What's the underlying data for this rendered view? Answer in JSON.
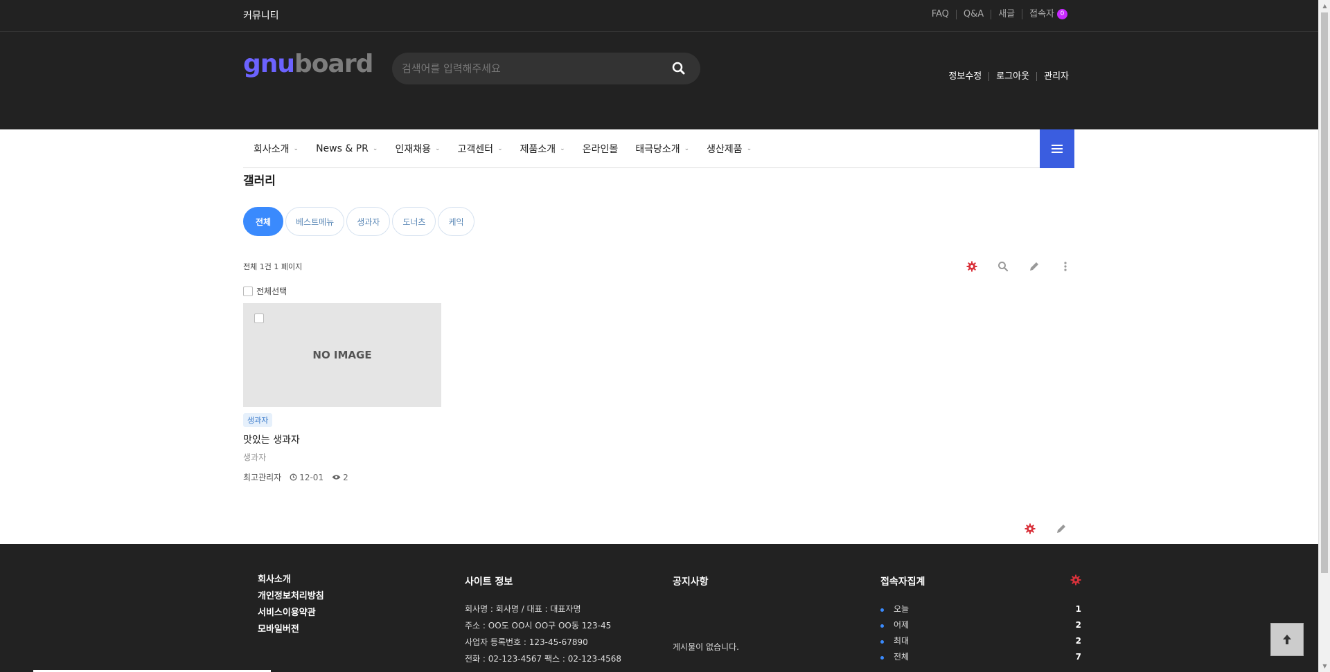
{
  "topbar": {
    "brand": "커뮤니티",
    "links": [
      "FAQ",
      "Q&A",
      "새글",
      "접속자"
    ],
    "visitor_count": "0"
  },
  "header": {
    "logo_part1": "gnu",
    "logo_part2": "board",
    "search_placeholder": "검색어를 입력해주세요",
    "user_links": [
      "정보수정",
      "로그아웃",
      "관리자"
    ]
  },
  "nav": {
    "items": [
      {
        "label": "회사소개",
        "dropdown": true
      },
      {
        "label": "News & PR",
        "dropdown": true
      },
      {
        "label": "인재채용",
        "dropdown": true
      },
      {
        "label": "고객센터",
        "dropdown": true
      },
      {
        "label": "제품소개",
        "dropdown": true
      },
      {
        "label": "온라인몰",
        "dropdown": false
      },
      {
        "label": "태극당소개",
        "dropdown": true
      },
      {
        "label": "생산제품",
        "dropdown": true
      }
    ],
    "menu_icon": "hamburger-icon"
  },
  "board": {
    "title": "갤러리",
    "categories": [
      "전체",
      "베스트메뉴",
      "생과자",
      "도너츠",
      "케익"
    ],
    "active_category": "전체",
    "total_text": "전체 1건 1 페이지",
    "select_all_label": "전체선택"
  },
  "posts": [
    {
      "thumb_text": "NO IMAGE",
      "category": "생과자",
      "title": "맛있는 생과자",
      "excerpt": "생과자",
      "author": "최고관리자",
      "date": "12-01",
      "views": "2"
    }
  ],
  "footer": {
    "links": [
      "회사소개",
      "개인정보처리방침",
      "서비스이용약관",
      "모바일버전"
    ],
    "site_info_title": "사이트 정보",
    "site_info": [
      "회사명 : 회사명 / 대표 : 대표자명",
      "주소 : OO도 OO시 OO구 OO동 123-45",
      "사업자 등록번호 : 123-45-67890",
      "전화 : 02-123-4567 팩스 : 02-123-4568"
    ],
    "notice_title": "공지사항",
    "notice_empty": "게시물이 없습니다.",
    "visit_title": "접속자집계",
    "visits": [
      {
        "label": "오늘",
        "value": "1"
      },
      {
        "label": "어제",
        "value": "2"
      },
      {
        "label": "최대",
        "value": "2"
      },
      {
        "label": "전체",
        "value": "7"
      }
    ]
  },
  "colors": {
    "dark_bg": "#222222",
    "accent_blue": "#3a8afd",
    "menu_blue": "#3a5de0",
    "gear_red": "#d9323b",
    "badge_purple": "#c829ff"
  }
}
